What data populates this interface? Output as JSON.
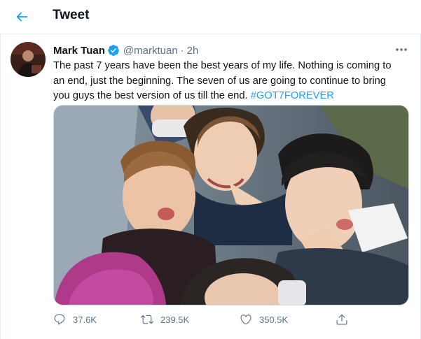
{
  "header": {
    "title": "Tweet"
  },
  "tweet": {
    "author": {
      "display_name": "Mark Tuan",
      "handle": "@marktuan",
      "verified": true
    },
    "separator": "·",
    "time": "2h",
    "text_lines": [
      "The past 7 years have been the best years of my life. Nothing is coming to",
      "an end, just the beginning. The seven of us are going to continue to bring",
      "you guys the best version of us till the end. "
    ],
    "hashtag": "#GOT7FOREVER",
    "media_alt": "Group selfie photo"
  },
  "actions": {
    "reply_count": "37.6K",
    "retweet_count": "239.5K",
    "like_count": "350.5K"
  },
  "icons": {
    "back": "arrow-left-icon",
    "verified": "verified-badge-icon",
    "more": "more-horizontal-icon",
    "reply": "reply-icon",
    "retweet": "retweet-icon",
    "like": "heart-icon",
    "share": "share-icon"
  },
  "colors": {
    "accent": "#1da1f2",
    "text": "#0f1419",
    "secondary": "#5b7083",
    "divider": "#e6ecf0"
  }
}
